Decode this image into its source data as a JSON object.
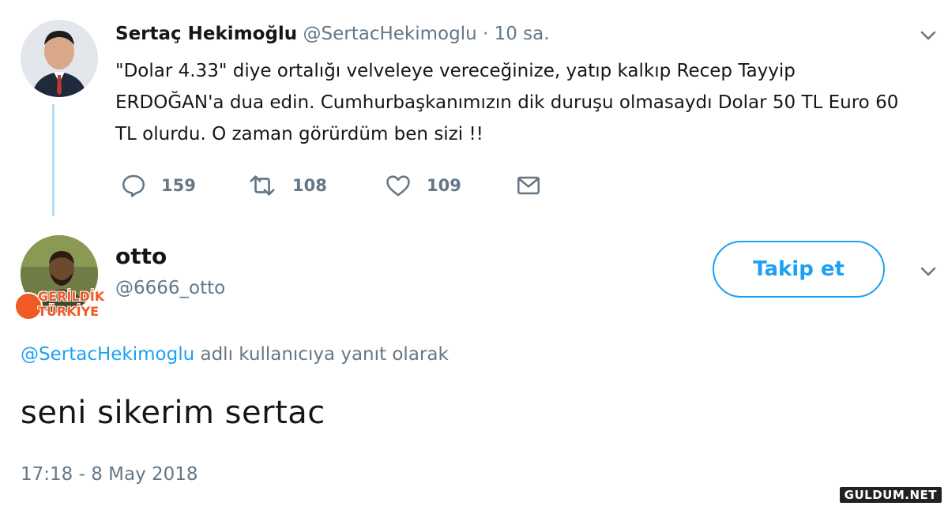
{
  "tweet": {
    "author_name": "Sertaç Hekimoğlu",
    "author_handle": "@SertacHekimoglu",
    "separator": "·",
    "time_ago": "10 sa.",
    "text": "\"Dolar 4.33\" diye ortalığı velveleye vereceğinize, yatıp kalkıp Recep Tayyip ERDOĞAN'a dua edin. Cumhurbaşkanımızın dik duruşu olmasaydı Dolar 50 TL Euro 60 TL olurdu. O zaman görürdüm ben sizi !!",
    "replies": "159",
    "retweets": "108",
    "likes": "109"
  },
  "reply": {
    "author_name": "otto",
    "author_handle": "@6666_otto",
    "follow_label": "Takip et",
    "reply_to_handle": "@SertacHekimoglu",
    "reply_to_suffix": "adlı kullanıcıya yanıt olarak",
    "text": "seni sikerim sertac",
    "timestamp": "17:18 - 8 May 2018"
  },
  "watermark": {
    "line1": "GERİLDİK",
    "line2": "TÜRKİYE"
  },
  "site_watermark": "GULDUM.NET",
  "colors": {
    "accent": "#1da1f2",
    "muted": "#657786",
    "thread_line": "#b3dcf7"
  }
}
